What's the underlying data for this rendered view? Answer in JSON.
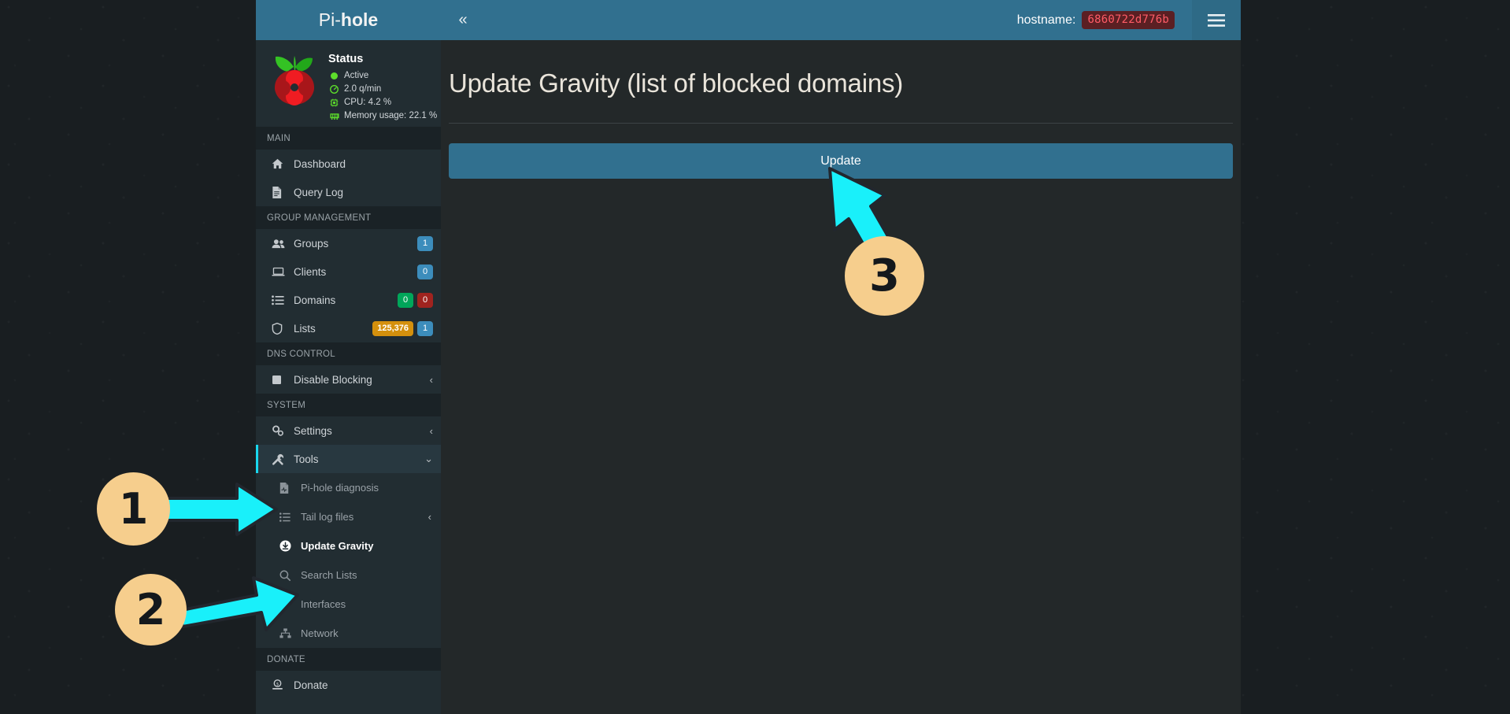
{
  "topbar": {
    "brand_prefix": "Pi-",
    "brand_suffix": "hole",
    "collapse_icon": "double-chevron-left-icon",
    "hostname_label": "hostname:",
    "hostname_value": "6860722d776b",
    "hamburger_icon": "hamburger-menu-icon"
  },
  "status": {
    "title": "Status",
    "rows": [
      {
        "icon": "green-dot-icon",
        "text": "Active"
      },
      {
        "icon": "speedometer-icon",
        "text": "2.0 q/min"
      },
      {
        "icon": "cpu-chip-icon",
        "text": "CPU: 4.2 %"
      },
      {
        "icon": "memory-ram-icon",
        "text": "Memory usage: 22.1 %"
      }
    ]
  },
  "sidebar": {
    "sections": [
      {
        "header": "MAIN",
        "items": [
          {
            "label": "Dashboard",
            "icon": "home-icon"
          },
          {
            "label": "Query Log",
            "icon": "file-document-icon"
          }
        ]
      },
      {
        "header": "GROUP MANAGEMENT",
        "items": [
          {
            "label": "Groups",
            "icon": "users-icon",
            "badges": [
              {
                "text": "1",
                "color": "blue"
              }
            ]
          },
          {
            "label": "Clients",
            "icon": "laptop-icon",
            "badges": [
              {
                "text": "0",
                "color": "blue"
              }
            ]
          },
          {
            "label": "Domains",
            "icon": "list-icon",
            "badges": [
              {
                "text": "0",
                "color": "green"
              },
              {
                "text": "0",
                "color": "red"
              }
            ]
          },
          {
            "label": "Lists",
            "icon": "shield-icon",
            "badges": [
              {
                "text": "125,376",
                "color": "orange"
              },
              {
                "text": "1",
                "color": "blue"
              }
            ]
          }
        ]
      },
      {
        "header": "DNS CONTROL",
        "items": [
          {
            "label": "Disable Blocking",
            "icon": "stop-square-icon",
            "chevron": "chevron-left-icon"
          }
        ]
      },
      {
        "header": "SYSTEM",
        "items": [
          {
            "label": "Settings",
            "icon": "gears-icon",
            "chevron": "chevron-left-icon"
          },
          {
            "label": "Tools",
            "icon": "tools-wrench-icon",
            "chevron": "chevron-down-icon",
            "active": true
          }
        ]
      }
    ],
    "tools_submenu": [
      {
        "label": "Pi-hole diagnosis",
        "icon": "file-medical-icon"
      },
      {
        "label": "Tail log files",
        "icon": "list-ul-icon",
        "chevron": "chevron-left-icon"
      },
      {
        "label": "Update Gravity",
        "icon": "download-circle-icon",
        "current": true
      },
      {
        "label": "Search Lists",
        "icon": "search-icon"
      },
      {
        "label": "Interfaces",
        "icon": "wifi-icon"
      },
      {
        "label": "Network",
        "icon": "network-nodes-icon"
      }
    ],
    "donate_section": {
      "header": "DONATE",
      "items": [
        {
          "label": "Donate",
          "icon": "donate-coin-icon"
        }
      ]
    }
  },
  "main": {
    "page_title": "Update Gravity (list of blocked domains)",
    "update_button": "Update"
  },
  "annotations": [
    {
      "number": "1",
      "target": "tools-nav-item"
    },
    {
      "number": "2",
      "target": "update-gravity-submenu-item"
    },
    {
      "number": "3",
      "target": "update-button"
    }
  ],
  "colors": {
    "accent_blue": "#31708f",
    "sidebar_bg": "#222d32",
    "annotation_circle": "#f6ce8d",
    "annotation_arrow": "#19f0fa",
    "status_green": "#5ddd2b",
    "badge_orange": "#d4900d"
  }
}
